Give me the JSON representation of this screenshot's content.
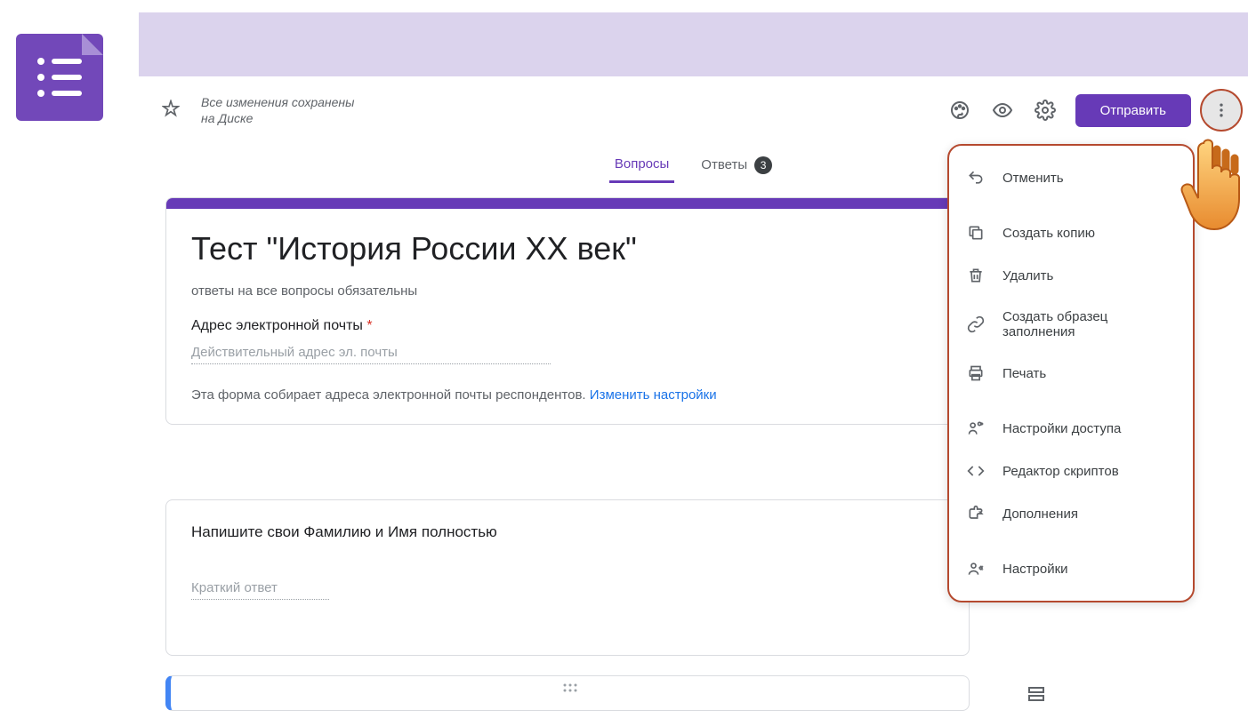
{
  "toolbar": {
    "save_status_line1": "Все изменения сохранены",
    "save_status_line2": "на Диске",
    "send_label": "Отправить"
  },
  "tabs": {
    "questions": "Вопросы",
    "answers": "Ответы",
    "answers_count": "3"
  },
  "form": {
    "title": "Тест \"История России XX век\"",
    "description": "ответы на все вопросы обязательны",
    "email_label": "Адрес электронной почты",
    "email_placeholder": "Действительный адрес эл. почты",
    "email_note": "Эта форма собирает адреса электронной почты респондентов.  ",
    "change_settings": "Изменить настройки"
  },
  "q1": {
    "title": "Напишите свои Фамилию и Имя полностью",
    "placeholder": "Краткий ответ"
  },
  "menu": {
    "undo": "Отменить",
    "copy": "Создать копию",
    "delete": "Удалить",
    "prefill": "Создать образец заполнения",
    "print": "Печать",
    "share": "Настройки доступа",
    "script": "Редактор скриптов",
    "addons": "Дополнения",
    "settings": "Настройки"
  }
}
